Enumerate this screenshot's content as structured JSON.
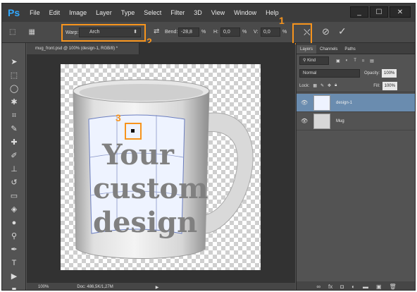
{
  "app": {
    "logo": "Ps"
  },
  "menu": [
    "File",
    "Edit",
    "Image",
    "Layer",
    "Type",
    "Select",
    "Filter",
    "3D",
    "View",
    "Window",
    "Help"
  ],
  "window_controls": [
    "_",
    "☐",
    "✕"
  ],
  "options": {
    "warp_label": "Warp:",
    "warp_value": "Arch",
    "bend_label": "Bend:",
    "bend_value": "-28,8",
    "bend_unit": "%",
    "h_label": "H:",
    "h_value": "0,0",
    "h_unit": "%",
    "v_label": "V:",
    "v_value": "0,0",
    "v_unit": "%"
  },
  "callouts": [
    "1",
    "2",
    "3"
  ],
  "document": {
    "tab": "mug_front.psd @ 100% (design-1, RGB/8) *",
    "design_lines": [
      "Your",
      "custom",
      "design"
    ]
  },
  "status": {
    "zoom": "100%",
    "doc": "Doc: 486,5K/1,27M"
  },
  "layers_panel": {
    "tabs": [
      "Layers",
      "Channels",
      "Paths"
    ],
    "kind": "Kind",
    "blend_mode": "Normal",
    "opacity_label": "Opacity:",
    "opacity_value": "100%",
    "lock_label": "Lock:",
    "fill_label": "Fill:",
    "fill_value": "100%",
    "layers": [
      "design-1",
      "Mug"
    ]
  },
  "colors": {
    "accent": "#f7941d",
    "selected_layer": "#6a8caf",
    "ps_blue": "#31a8ff"
  }
}
